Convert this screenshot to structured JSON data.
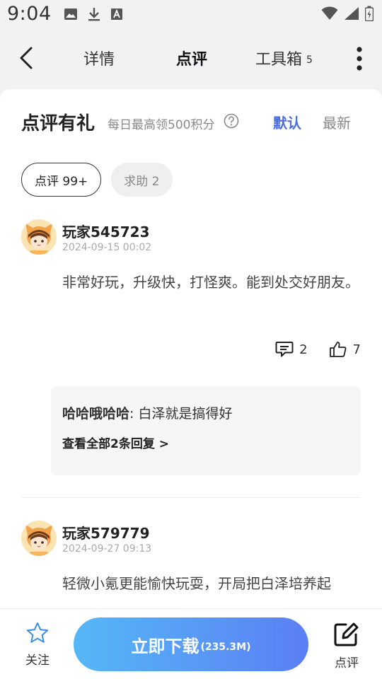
{
  "status_bar": {
    "time": "9:04",
    "left_icons": [
      "image-icon",
      "download-icon",
      "font-a-icon"
    ],
    "right_icons": [
      "wifi-icon",
      "signal-icon",
      "battery-icon"
    ]
  },
  "nav": {
    "tabs": [
      {
        "label": "详情",
        "active": false
      },
      {
        "label": "点评",
        "active": true
      },
      {
        "label": "工具箱",
        "badge": "5",
        "active": false
      }
    ]
  },
  "section": {
    "title": "点评有礼",
    "subtitle": "每日最高领500积分",
    "sort_options": [
      {
        "label": "默认",
        "active": true
      },
      {
        "label": "最新",
        "active": false
      }
    ]
  },
  "filters": [
    {
      "label": "点评 99+",
      "active": true
    },
    {
      "label": "求助 2",
      "active": false
    }
  ],
  "reviews": [
    {
      "user": "玩家545723",
      "time": "2024-09-15 00:02",
      "text": "非常好玩，升级快，打怪爽。能到处交好朋友。",
      "comments": "2",
      "likes": "7",
      "reply": {
        "user": "哈哈哦哈哈",
        "separator": ": ",
        "text": "白泽就是搞得好",
        "view_all": "查看全部2条回复 >"
      }
    },
    {
      "user": "玩家579779",
      "time": "2024-09-27 09:13",
      "text": "轻微小氪更能愉快玩耍，开局把白泽培养起"
    }
  ],
  "bottom": {
    "follow_label": "关注",
    "download_label": "立即下载",
    "download_size": "(235.3M)",
    "comment_label": "点评"
  },
  "colors": {
    "accent": "#4a6ee0",
    "download_gradient_start": "#55b8f6",
    "download_gradient_end": "#5b7ef5",
    "follow_star": "#3a8ee6"
  }
}
